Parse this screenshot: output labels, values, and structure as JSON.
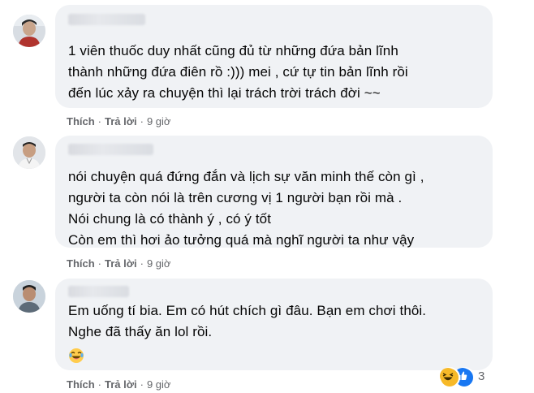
{
  "comments": [
    {
      "lines": [
        "1 viên thuốc duy nhất cũng đủ từ những đứa bản lĩnh",
        "thành những đứa điên rồ :))) mei , cứ tự tin bản lĩnh rồi",
        "đến lúc xảy ra chuyện thì lại trách trời trách đời ~~"
      ],
      "like_label": "Thích",
      "reply_label": "Trả lời",
      "time": "9 giờ"
    },
    {
      "lines": [
        "nói chuyện quá đứng đắn và lịch sự văn minh thế còn gì ,",
        "người ta còn nói là trên cương vị 1 người bạn rồi mà .",
        "Nói chung là có thành ý , có ý tốt",
        "Còn em thì hơi ảo tưởng quá mà nghĩ người ta như vậy"
      ],
      "like_label": "Thích",
      "reply_label": "Trả lời",
      "time": "9 giờ"
    },
    {
      "lines": [
        "Em uống tí bia. Em có hút chích gì đâu. Bạn em chơi thôi.",
        "Nghe đã thấy ăn lol rồi."
      ],
      "emoji": "laughing-emoji",
      "like_label": "Thích",
      "reply_label": "Trả lời",
      "time": "9 giờ",
      "reactions": {
        "icons": [
          "haha-reaction-icon",
          "like-reaction-icon"
        ],
        "count": "3"
      }
    }
  ],
  "colors": {
    "bubble": "#f0f2f5",
    "action_text": "#65676b",
    "like_blue": "#1877f2",
    "haha_yellow": "#f7b928"
  }
}
